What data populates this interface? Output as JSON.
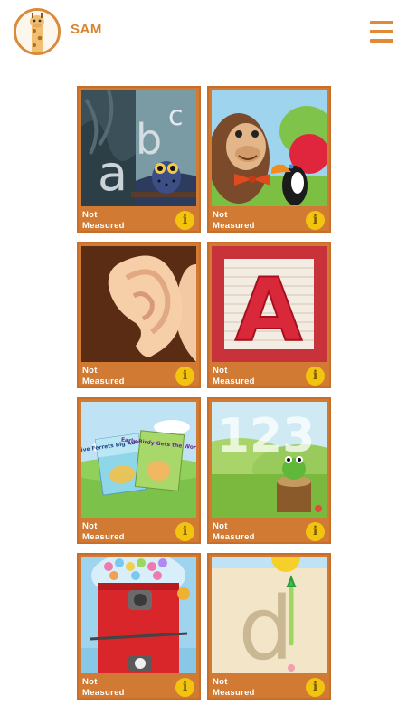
{
  "header": {
    "username": "SAM",
    "avatar_icon": "giraffe-avatar-icon",
    "menu_icon": "hamburger-menu-icon"
  },
  "colors": {
    "accent": "#d9852f",
    "tile_border": "#d07a34",
    "info_badge": "#f2c40f"
  },
  "tiles": [
    {
      "name": "alphabet-owl",
      "status_line1": "Not",
      "status_line2": "Measured",
      "info": "i"
    },
    {
      "name": "animal-sounds",
      "status_line1": "Not",
      "status_line2": "Measured",
      "info": "i"
    },
    {
      "name": "listening-ear",
      "status_line1": "Not",
      "status_line2": "Measured",
      "info": "i"
    },
    {
      "name": "letter-block-a",
      "status_line1": "Not",
      "status_line2": "Measured",
      "info": "i"
    },
    {
      "name": "storybooks",
      "status_line1": "Not",
      "status_line2": "Measured",
      "info": "i"
    },
    {
      "name": "numbers-frog",
      "status_line1": "Not",
      "status_line2": "Measured",
      "info": "i"
    },
    {
      "name": "gumball-machine",
      "status_line1": "Not",
      "status_line2": "Measured",
      "info": "i"
    },
    {
      "name": "letter-tracing",
      "status_line1": "Not",
      "status_line2": "Measured",
      "info": "i"
    }
  ],
  "art_text": {
    "abc_a": "a",
    "abc_b": "b",
    "abc_c": "c",
    "block_letter": "A",
    "book1_title": "Five Ferrets Big Adventure",
    "book2_title": "Early Birdy Gets the Worm",
    "numbers": "123",
    "trace_letter": "d"
  }
}
